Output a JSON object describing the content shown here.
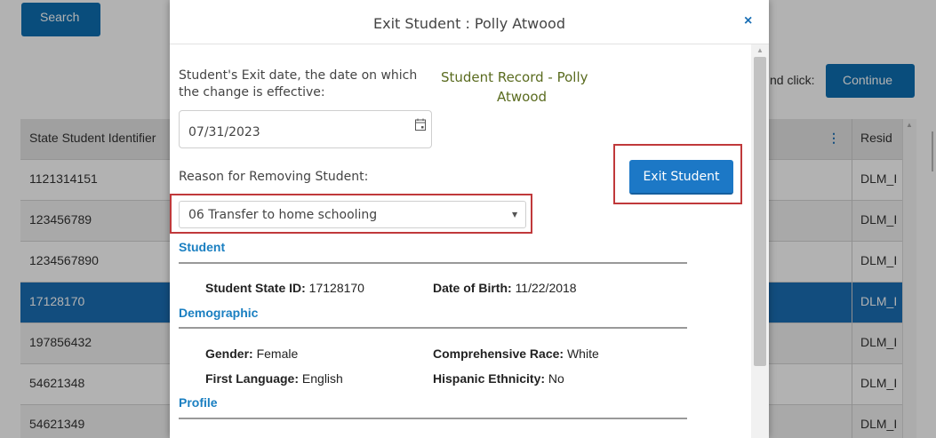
{
  "background": {
    "search_label": "Search",
    "click_text": "nd click:",
    "continue_label": "Continue",
    "table": {
      "header_col1": "State Student Identifier",
      "header_col2": "Resid",
      "rows": [
        {
          "id": "1121314151",
          "res": "DLM_I"
        },
        {
          "id": "123456789",
          "res": "DLM_I"
        },
        {
          "id": "1234567890",
          "res": "DLM_I"
        },
        {
          "id": "17128170",
          "res": "DLM_I"
        },
        {
          "id": "197856432",
          "res": "DLM_I"
        },
        {
          "id": "54621348",
          "res": "DLM_I"
        },
        {
          "id": "54621349",
          "res": "DLM_I"
        }
      ]
    }
  },
  "modal": {
    "title": "Exit Student : Polly Atwood",
    "close_glyph": "×",
    "exit_date_label": "Student's Exit date, the date on which the change is effective:",
    "record_title_line1": "Student Record - Polly",
    "record_title_line2": "Atwood",
    "exit_date_value": "07/31/2023",
    "exit_button_label": "Exit Student",
    "reason_label": "Reason for Removing Student:",
    "reason_value": "06 Transfer to home schooling",
    "sections": {
      "student": "Student",
      "demographic": "Demographic",
      "profile": "Profile"
    },
    "student_fields": {
      "state_id_label": "Student State ID:",
      "state_id_value": "17128170",
      "dob_label": "Date of Birth:",
      "dob_value": "11/22/2018"
    },
    "demographic_fields": {
      "gender_label": "Gender:",
      "gender_value": "Female",
      "race_label": "Comprehensive Race:",
      "race_value": "White",
      "language_label": "First Language:",
      "language_value": "English",
      "hispanic_label": "Hispanic Ethnicity:",
      "hispanic_value": "No"
    }
  },
  "colors": {
    "primary_blue": "#1c78c6",
    "highlight_red": "#c0393b",
    "record_title_green": "#5a6b1f",
    "section_blue": "#1a7fc1"
  }
}
